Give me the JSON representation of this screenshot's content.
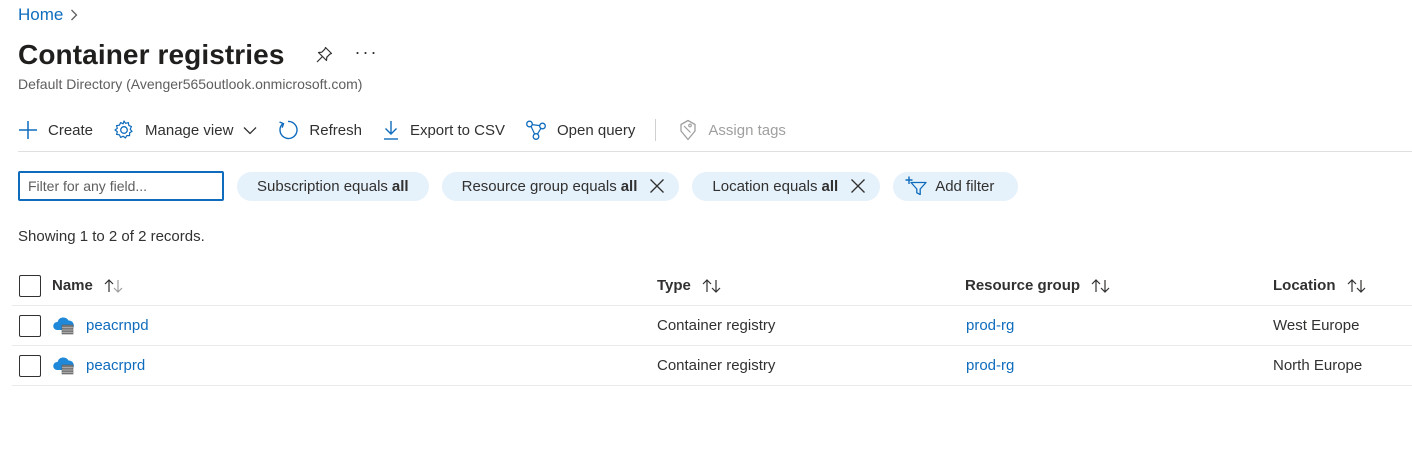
{
  "breadcrumb": {
    "home": "Home"
  },
  "header": {
    "title": "Container registries",
    "subtitle": "Default Directory (Avenger565outlook.onmicrosoft.com)",
    "more": "···"
  },
  "toolbar": {
    "create": "Create",
    "manage_view": "Manage view",
    "refresh": "Refresh",
    "export_csv": "Export to CSV",
    "open_query": "Open query",
    "assign_tags": "Assign tags"
  },
  "filters": {
    "search_placeholder": "Filter for any field...",
    "search_value": "",
    "pills": [
      {
        "label": "Subscription equals",
        "value": "all",
        "removable": false
      },
      {
        "label": "Resource group equals",
        "value": "all",
        "removable": true
      },
      {
        "label": "Location equals",
        "value": "all",
        "removable": true
      }
    ],
    "add_filter": "Add filter"
  },
  "records_text": "Showing 1 to 2 of 2 records.",
  "table": {
    "columns": {
      "name": "Name",
      "type": "Type",
      "resource_group": "Resource group",
      "location": "Location"
    },
    "rows": [
      {
        "name": "peacrnpd",
        "type": "Container registry",
        "resource_group": "prod-rg",
        "location": "West Europe"
      },
      {
        "name": "peacrprd",
        "type": "Container registry",
        "resource_group": "prod-rg",
        "location": "North Europe"
      }
    ]
  },
  "colors": {
    "accent": "#0f6cbd",
    "pill_bg": "#e5f1fb",
    "text": "#323130",
    "muted": "#605e5c",
    "disabled": "#a19f9d"
  },
  "icons": {
    "breadcrumb_sep": "chevron-right-icon",
    "pin": "pin-icon",
    "create": "plus-icon",
    "manage_view": "gear-icon",
    "refresh": "refresh-icon",
    "export": "download-icon",
    "query": "share-nodes-icon",
    "tags": "tag-icon",
    "remove": "close-icon",
    "add_filter": "filter-add-icon",
    "sort": "sort-arrows-icon",
    "registry": "container-registry-icon"
  }
}
